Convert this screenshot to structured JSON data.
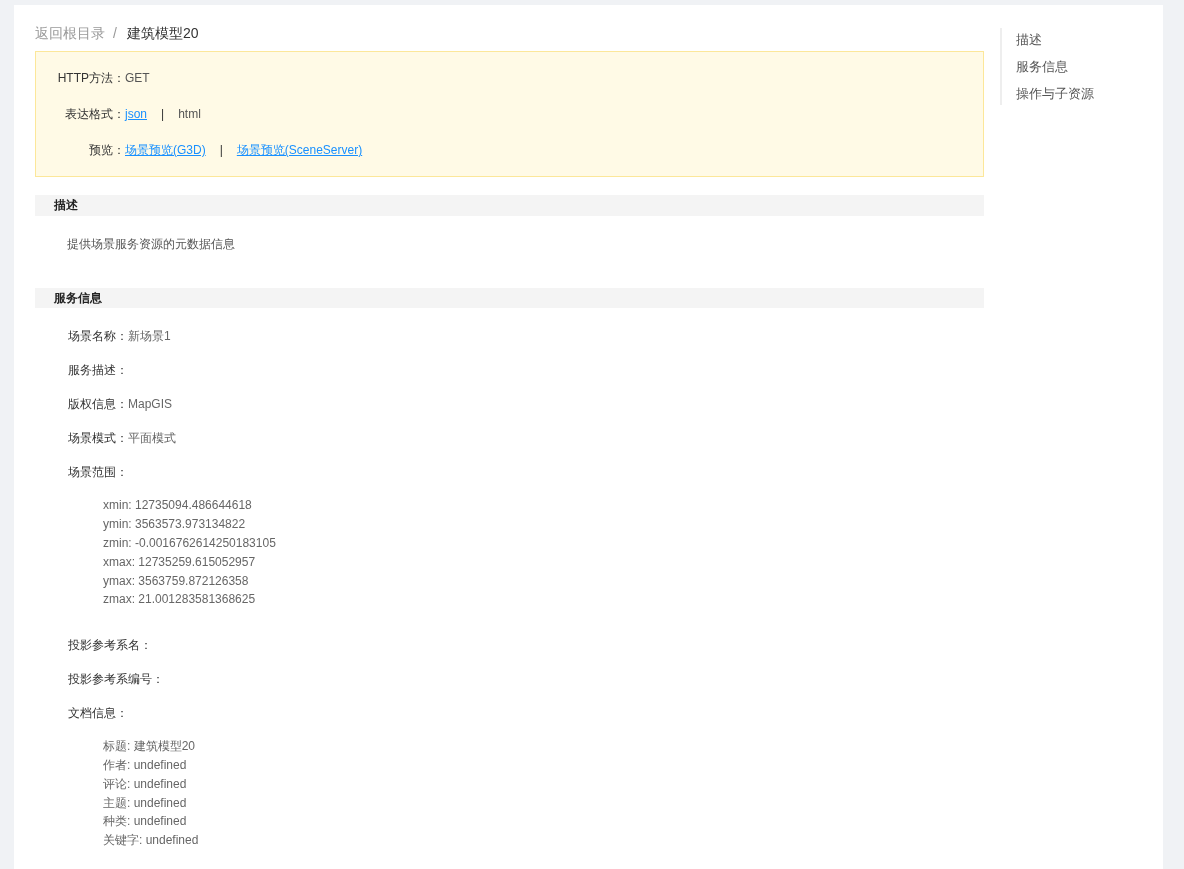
{
  "breadcrumb": {
    "root": "返回根目录",
    "separator": "/",
    "current": "建筑模型20"
  },
  "info_box": {
    "rows": [
      {
        "label": "HTTP方法：",
        "items": [
          {
            "kind": "text",
            "text": "GET"
          }
        ]
      },
      {
        "label": "表达格式：",
        "items": [
          {
            "kind": "link",
            "text": "json"
          },
          {
            "kind": "separator",
            "text": "|"
          },
          {
            "kind": "text",
            "text": "html"
          }
        ]
      },
      {
        "label": "预览：",
        "items": [
          {
            "kind": "link",
            "text": "场景预览(G3D)"
          },
          {
            "kind": "separator",
            "text": "|"
          },
          {
            "kind": "link",
            "text": "场景预览(SceneServer)"
          }
        ]
      }
    ]
  },
  "sections": [
    {
      "title": "描述",
      "paragraph": "提供场景服务资源的元数据信息"
    },
    {
      "title": "服务信息",
      "fields": [
        {
          "label": "场景名称：",
          "value": "新场景1"
        },
        {
          "label": "服务描述："
        },
        {
          "label": "版权信息：",
          "value": "MapGIS"
        },
        {
          "label": "场景模式：",
          "value": "平面模式"
        },
        {
          "label": "场景范围：",
          "lines": [
            "xmin: 12735094.486644618",
            "ymin: 3563573.973134822",
            "zmin: -0.0016762614250183105",
            "xmax: 12735259.615052957",
            "ymax: 3563759.872126358",
            "zmax: 21.001283581368625"
          ]
        },
        {
          "label": "投影参考系名："
        },
        {
          "label": "投影参考系编号："
        },
        {
          "label": "文档信息：",
          "lines": [
            "标题: 建筑模型20",
            "作者: undefined",
            "评论: undefined",
            "主题: undefined",
            "种类: undefined",
            "关键字: undefined"
          ]
        }
      ]
    }
  ],
  "toc": [
    "描述",
    "服务信息",
    "操作与子资源"
  ]
}
